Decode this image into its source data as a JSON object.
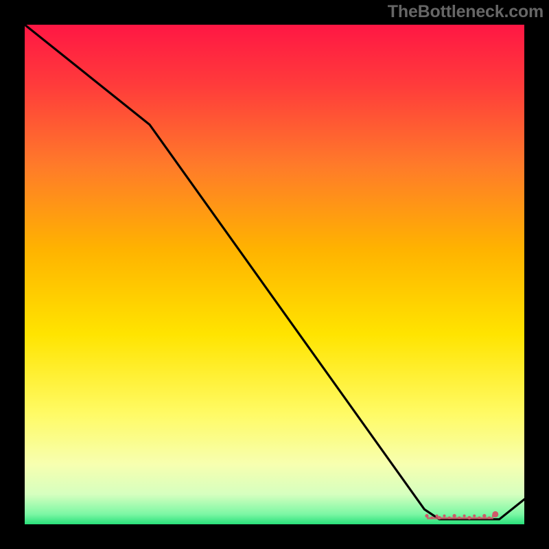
{
  "watermark": "TheBottleneck.com",
  "colors": {
    "line": "#000000",
    "marker": "#cf5a6a",
    "page_bg": "#000000"
  },
  "chart_data": {
    "type": "line",
    "title": "",
    "xlabel": "",
    "ylabel": "",
    "xlim": [
      0,
      100
    ],
    "ylim": [
      0,
      100
    ],
    "gradient_stops": [
      {
        "offset": 0,
        "color": "#ff1744"
      },
      {
        "offset": 12,
        "color": "#ff3b3b"
      },
      {
        "offset": 28,
        "color": "#ff7a2a"
      },
      {
        "offset": 45,
        "color": "#ffb300"
      },
      {
        "offset": 62,
        "color": "#ffe400"
      },
      {
        "offset": 78,
        "color": "#fffb66"
      },
      {
        "offset": 88,
        "color": "#f7ffb0"
      },
      {
        "offset": 94,
        "color": "#d6ffbf"
      },
      {
        "offset": 98,
        "color": "#7bf7a4"
      },
      {
        "offset": 100,
        "color": "#29e07a"
      }
    ],
    "series": [
      {
        "name": "bottleneck-curve",
        "x": [
          0,
          25,
          80,
          83,
          90,
          95,
          100
        ],
        "values": [
          100,
          80,
          3,
          1,
          1,
          1,
          5
        ]
      }
    ],
    "optimum_markers": {
      "xs": [
        80.5,
        81.5,
        82.5,
        83,
        84,
        85,
        86,
        87,
        88,
        89,
        90,
        91,
        92,
        93,
        93.8
      ],
      "y": 1.5,
      "end_marker": {
        "x": 94.2,
        "y": 2.0,
        "r": 4.5
      }
    }
  }
}
